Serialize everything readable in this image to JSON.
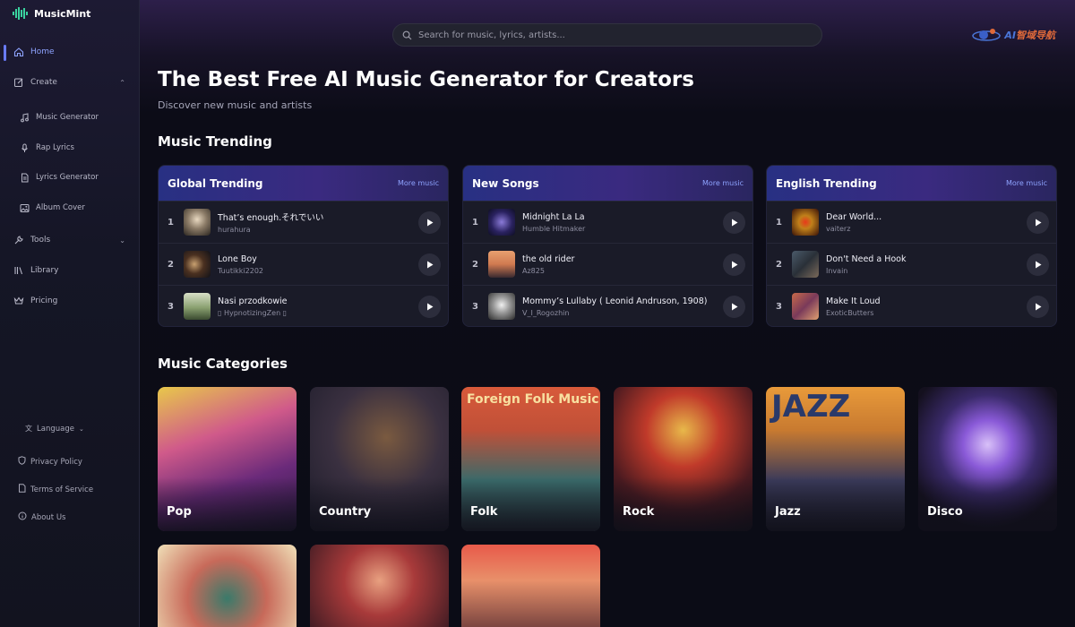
{
  "app": {
    "name": "MusicMint"
  },
  "sidebar": {
    "home": "Home",
    "create": "Create",
    "create_items": [
      "Music Generator",
      "Rap Lyrics",
      "Lyrics Generator",
      "Album Cover"
    ],
    "tools": "Tools",
    "library": "Library",
    "pricing": "Pricing",
    "language": "Language",
    "footer": [
      "Privacy Policy",
      "Terms of Service",
      "About Us"
    ]
  },
  "search": {
    "placeholder": "Search for music, lyrics, artists..."
  },
  "partner": {
    "logo_text": "AI",
    "cn_text": "智域导航"
  },
  "hero": {
    "title": "The Best Free AI Music Generator for Creators",
    "subtitle": "Discover new music and artists"
  },
  "trending": {
    "section_title": "Music Trending",
    "more_label": "More music",
    "cards": [
      {
        "title": "Global Trending",
        "songs": [
          {
            "rank": "1",
            "title": "That’s enough.それでいい",
            "artist": "hurahura"
          },
          {
            "rank": "2",
            "title": "Lone Boy",
            "artist": "Tuutikki2202"
          },
          {
            "rank": "3",
            "title": "Nasi przodkowie",
            "artist": "▯ HypnotizingZen ▯"
          }
        ]
      },
      {
        "title": "New Songs",
        "songs": [
          {
            "rank": "1",
            "title": "Midnight La La",
            "artist": "Humble Hitmaker"
          },
          {
            "rank": "2",
            "title": "the old rider",
            "artist": "Az825"
          },
          {
            "rank": "3",
            "title": "Mommy’s Lullaby ( Leonid Andruson, 1908)",
            "artist": "V_I_Rogozhin"
          }
        ]
      },
      {
        "title": "English Trending",
        "songs": [
          {
            "rank": "1",
            "title": "Dear World...",
            "artist": "vaiterz"
          },
          {
            "rank": "2",
            "title": "Don't Need a Hook",
            "artist": "Invain"
          },
          {
            "rank": "3",
            "title": "Make It Loud",
            "artist": "ExoticButters"
          }
        ]
      }
    ]
  },
  "categories": {
    "section_title": "Music Categories",
    "items": [
      {
        "label": "Pop"
      },
      {
        "label": "Country"
      },
      {
        "label": "Folk"
      },
      {
        "label": "Rock"
      },
      {
        "label": "Jazz"
      },
      {
        "label": "Disco"
      },
      {
        "label": ""
      },
      {
        "label": ""
      },
      {
        "label": ""
      }
    ],
    "folk_banner": "Foreign Folk Music",
    "jazz_banner": "JAZZ"
  },
  "colors": {
    "accent": "#8ea3ff",
    "background": "#0b0c16",
    "sidebar": "#151626"
  }
}
